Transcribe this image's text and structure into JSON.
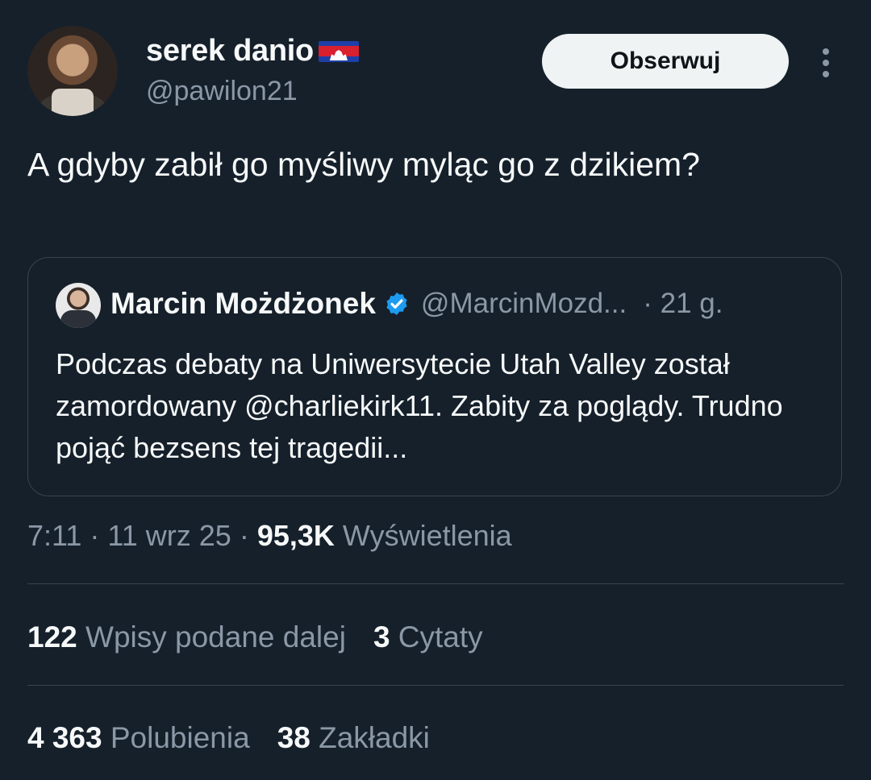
{
  "author": {
    "display_name": "serek danio",
    "handle": "@pawilon21",
    "flag_icon": "cambodia-flag-emoji"
  },
  "follow_label": "Obserwuj",
  "tweet_text": "A gdyby zabił go myśliwy myląc go z dzikiem?",
  "quote": {
    "author_name": "Marcin Możdżonek",
    "handle": "@MarcinMozd...",
    "time": "· 21 g.",
    "text": "Podczas debaty na Uniwersytecie Utah Valley został zamordowany @charliekirk11. Zabity za poglądy. Trudno pojąć bezsens tej tragedii..."
  },
  "meta": {
    "time": "7:11",
    "date": "11 wrz 25",
    "views_count": "95,3K",
    "views_label": "Wyświetlenia"
  },
  "stats": {
    "reposts_count": "122",
    "reposts_label": "Wpisy podane dalej",
    "quotes_count": "3",
    "quotes_label": "Cytaty",
    "likes_count": "4 363",
    "likes_label": "Polubienia",
    "bookmarks_count": "38",
    "bookmarks_label": "Zakładki"
  },
  "colors": {
    "background": "#15202b",
    "text": "#f7f9f9",
    "muted": "#8b98a5",
    "border": "#38444d",
    "verified": "#1d9bf0"
  }
}
